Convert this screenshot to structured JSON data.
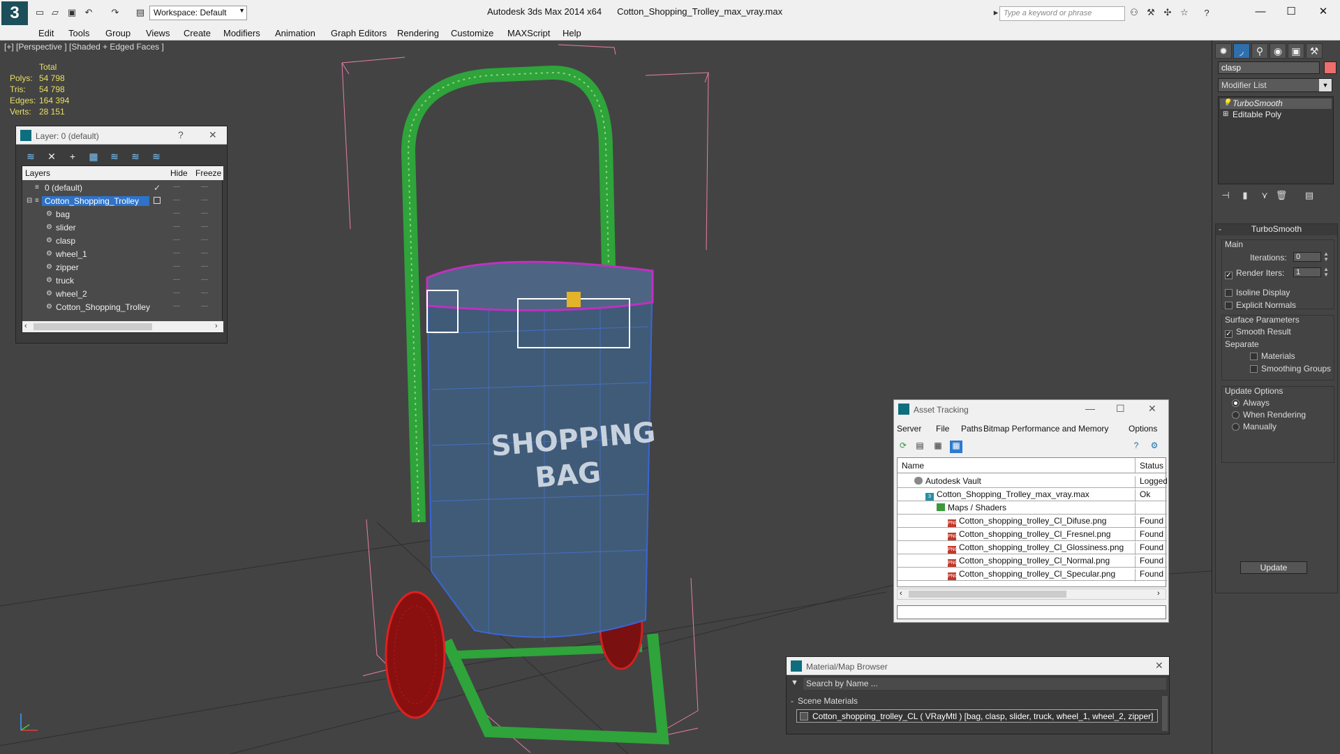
{
  "titlebar": {
    "app_title": "Autodesk 3ds Max  2014 x64",
    "file_title": "Cotton_Shopping_Trolley_max_vray.max",
    "workspace": "Workspace: Default",
    "search_placeholder": "Type a keyword or phrase"
  },
  "menu": [
    "Edit",
    "Tools",
    "Group",
    "Views",
    "Create",
    "Modifiers",
    "Animation",
    "Graph Editors",
    "Rendering",
    "Customize",
    "MAXScript",
    "Help"
  ],
  "viewport": {
    "label": "[+] [Perspective ] [Shaded + Edged Faces ]",
    "stats": {
      "header": "Total",
      "rows": [
        {
          "label": "Polys:",
          "value": "54 798"
        },
        {
          "label": "Tris:",
          "value": "54 798"
        },
        {
          "label": "Edges:",
          "value": "164 394"
        },
        {
          "label": "Verts:",
          "value": "28 151"
        }
      ]
    },
    "bag_text_1": "SHOPPING",
    "bag_text_2": "BAG"
  },
  "layer_panel": {
    "title": "Layer: 0 (default)",
    "help": "?",
    "columns": {
      "layers": "Layers",
      "hide": "Hide",
      "freeze": "Freeze"
    },
    "rows": [
      {
        "name": "0 (default)",
        "indent": 0
      },
      {
        "name": "Cotton_Shopping_Trolley",
        "indent": 1,
        "selected": true
      },
      {
        "name": "bag",
        "indent": 2
      },
      {
        "name": "slider",
        "indent": 2
      },
      {
        "name": "clasp",
        "indent": 2
      },
      {
        "name": "wheel_1",
        "indent": 2
      },
      {
        "name": "zipper",
        "indent": 2
      },
      {
        "name": "truck",
        "indent": 2
      },
      {
        "name": "wheel_2",
        "indent": 2
      },
      {
        "name": "Cotton_Shopping_Trolley",
        "indent": 2
      }
    ]
  },
  "command_panel": {
    "object_name": "clasp",
    "modifier_list": "Modifier List",
    "stack": [
      "TurboSmooth",
      "Editable Poly"
    ],
    "turbosmooth": {
      "title": "TurboSmooth",
      "main": "Main",
      "iterations_label": "Iterations:",
      "iterations_value": "0",
      "render_iters_label": "Render Iters:",
      "render_iters_value": "1",
      "isoline": "Isoline Display",
      "explicit_normals": "Explicit Normals",
      "surface_params": "Surface Parameters",
      "smooth_result": "Smooth Result",
      "separate": "Separate",
      "materials": "Materials",
      "smoothing_groups": "Smoothing Groups",
      "update_options": "Update Options",
      "always": "Always",
      "when_rendering": "When Rendering",
      "manually": "Manually",
      "update": "Update"
    }
  },
  "asset_tracking": {
    "title": "Asset Tracking",
    "menu": [
      "Server",
      "File",
      "Paths",
      "Bitmap Performance and Memory",
      "Options"
    ],
    "columns": {
      "name": "Name",
      "status": "Status"
    },
    "rows": [
      {
        "name": "Autodesk Vault",
        "status": "Logged Out",
        "indent": 0
      },
      {
        "name": "Cotton_Shopping_Trolley_max_vray.max",
        "status": "Ok",
        "indent": 1
      },
      {
        "name": "Maps / Shaders",
        "status": "",
        "indent": 2
      },
      {
        "name": "Cotton_shopping_trolley_Cl_Difuse.png",
        "status": "Found",
        "indent": 3
      },
      {
        "name": "Cotton_shopping_trolley_Cl_Fresnel.png",
        "status": "Found",
        "indent": 3
      },
      {
        "name": "Cotton_shopping_trolley_Cl_Glossiness.png",
        "status": "Found",
        "indent": 3
      },
      {
        "name": "Cotton_shopping_trolley_Cl_Normal.png",
        "status": "Found",
        "indent": 3
      },
      {
        "name": "Cotton_shopping_trolley_Cl_Specular.png",
        "status": "Found",
        "indent": 3
      }
    ]
  },
  "material_browser": {
    "title": "Material/Map Browser",
    "search_placeholder": "Search by Name ...",
    "section": "Scene Materials",
    "item": "Cotton_shopping_trolley_CL  ( VRayMtl ) [bag, clasp, slider, truck, wheel_1, wheel_2, zipper]"
  }
}
